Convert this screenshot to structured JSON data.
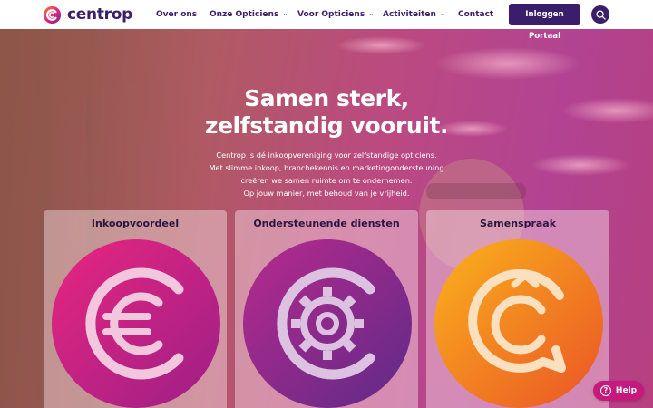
{
  "brand": {
    "name": "centrop",
    "color_primary": "#3a1e6b",
    "color_accent": "#e2237f"
  },
  "nav": {
    "items": [
      {
        "label": "Over ons",
        "has_dropdown": false
      },
      {
        "label": "Onze Opticiens",
        "has_dropdown": true
      },
      {
        "label": "Voor Opticiens",
        "has_dropdown": true
      },
      {
        "label": "Activiteiten",
        "has_dropdown": true
      },
      {
        "label": "Contact",
        "has_dropdown": false
      }
    ],
    "login_label": "Inloggen Portaal",
    "search_icon": "search-icon"
  },
  "hero": {
    "title_line1": "Samen sterk,",
    "title_line2": "zelfstandig vooruit.",
    "subtitle_lines": [
      "Centrop is dé inkoopvereniging voor zelfstandige opticiens.",
      "Met slimme inkoop, branchekennis en marketingondersteuning",
      "creëren we samen ruimte om te ondernemen.",
      "Op jouw manier, met behoud van je vrijheid."
    ]
  },
  "cards": [
    {
      "title": "Inkoopvoordeel",
      "icon": "euro-icon",
      "gradient": [
        "#e2237f",
        "#9c1f87"
      ]
    },
    {
      "title": "Ondersteunende diensten",
      "icon": "gear-icon",
      "gradient": [
        "#b02a8e",
        "#6a2a88"
      ]
    },
    {
      "title": "Samenspraak",
      "icon": "speech-bubble-icon",
      "gradient": [
        "#f8a41a",
        "#ea5b26"
      ]
    }
  ],
  "help": {
    "label": "Help",
    "icon": "question-icon"
  }
}
